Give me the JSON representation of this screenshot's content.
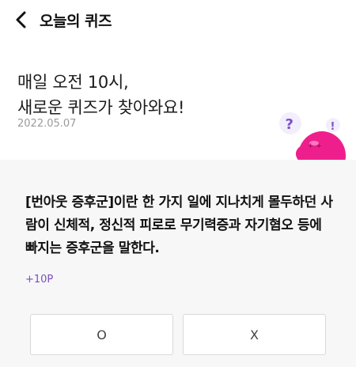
{
  "header": {
    "title": "오늘의 퀴즈"
  },
  "hero": {
    "line1": "매일 오전 10시,",
    "line2": "새로운 퀴즈가 찾아와요!",
    "date": "2022.05.07"
  },
  "quiz": {
    "question": "[번아웃 증후군]이란 한 가지 일에 지나치게 몰두하던 사람이 신체적, 정신적 피로로 무기력증과 자기혐오 등에 빠지는 증후군을 말한다.",
    "reward": "+10P",
    "option_o": "O",
    "option_x": "X"
  },
  "icons": {
    "back": "chevron-left-icon",
    "mascot": "quiz-mascot-character"
  },
  "colors": {
    "reward": "#7a4fbf",
    "mascot": "#ee1f8c",
    "question_mark": "#7b52c9"
  }
}
